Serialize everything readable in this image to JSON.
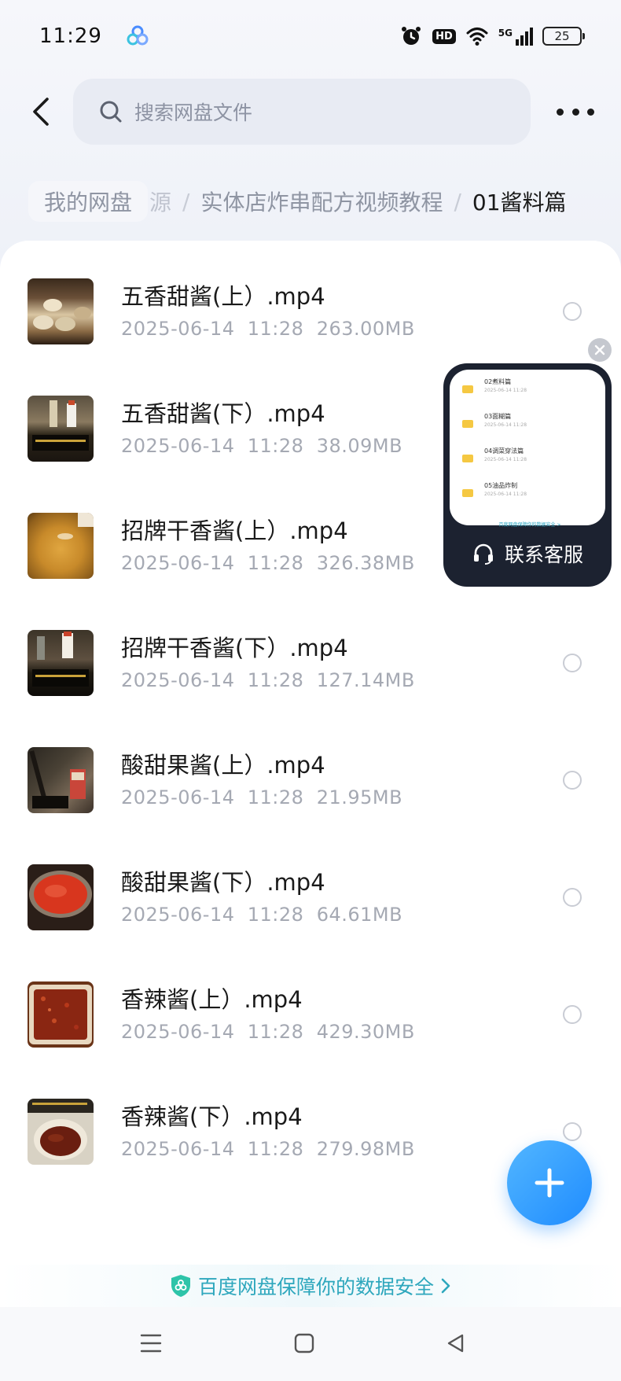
{
  "status_bar": {
    "time": "11:29",
    "hd_label": "HD",
    "network_label": "5G",
    "battery_level": "25"
  },
  "header": {
    "search_placeholder": "搜索网盘文件"
  },
  "breadcrumb": {
    "home": "我的网盘",
    "faded_fragment": "源",
    "folder": "实体店炸串配方视频教程",
    "separator": "/",
    "current": "01酱料篇"
  },
  "files": [
    {
      "name": "五香甜酱(上）.mp4",
      "date": "2025-06-14",
      "time": "11:28",
      "size": "263.00MB"
    },
    {
      "name": "五香甜酱(下）.mp4",
      "date": "2025-06-14",
      "time": "11:28",
      "size": "38.09MB"
    },
    {
      "name": "招牌干香酱(上）.mp4",
      "date": "2025-06-14",
      "time": "11:28",
      "size": "326.38MB"
    },
    {
      "name": "招牌干香酱(下）.mp4",
      "date": "2025-06-14",
      "time": "11:28",
      "size": "127.14MB"
    },
    {
      "name": "酸甜果酱(上）.mp4",
      "date": "2025-06-14",
      "time": "11:28",
      "size": "21.95MB"
    },
    {
      "name": "酸甜果酱(下）.mp4",
      "date": "2025-06-14",
      "time": "11:28",
      "size": "64.61MB"
    },
    {
      "name": "香辣酱(上）.mp4",
      "date": "2025-06-14",
      "time": "11:28",
      "size": "429.30MB"
    },
    {
      "name": "香辣酱(下）.mp4",
      "date": "2025-06-14",
      "time": "11:28",
      "size": "279.98MB"
    }
  ],
  "float_preview": {
    "items": [
      {
        "title": "02煮料篇",
        "date": "2025-06-14 11:28"
      },
      {
        "title": "03面糊篇",
        "date": "2025-06-14 11:28"
      },
      {
        "title": "04调菜穿法篇",
        "date": "2025-06-14 11:28"
      },
      {
        "title": "05油品炸制",
        "date": "2025-06-14 11:28"
      }
    ],
    "safety_note": "百度网盘保障你的数据安全 >",
    "contact_label": "联系客服"
  },
  "safety_banner": {
    "text": "百度网盘保障你的数据安全"
  },
  "colors": {
    "accent": "#1f8cff",
    "safety": "#2ea7bd",
    "folder": "#f5c842"
  }
}
